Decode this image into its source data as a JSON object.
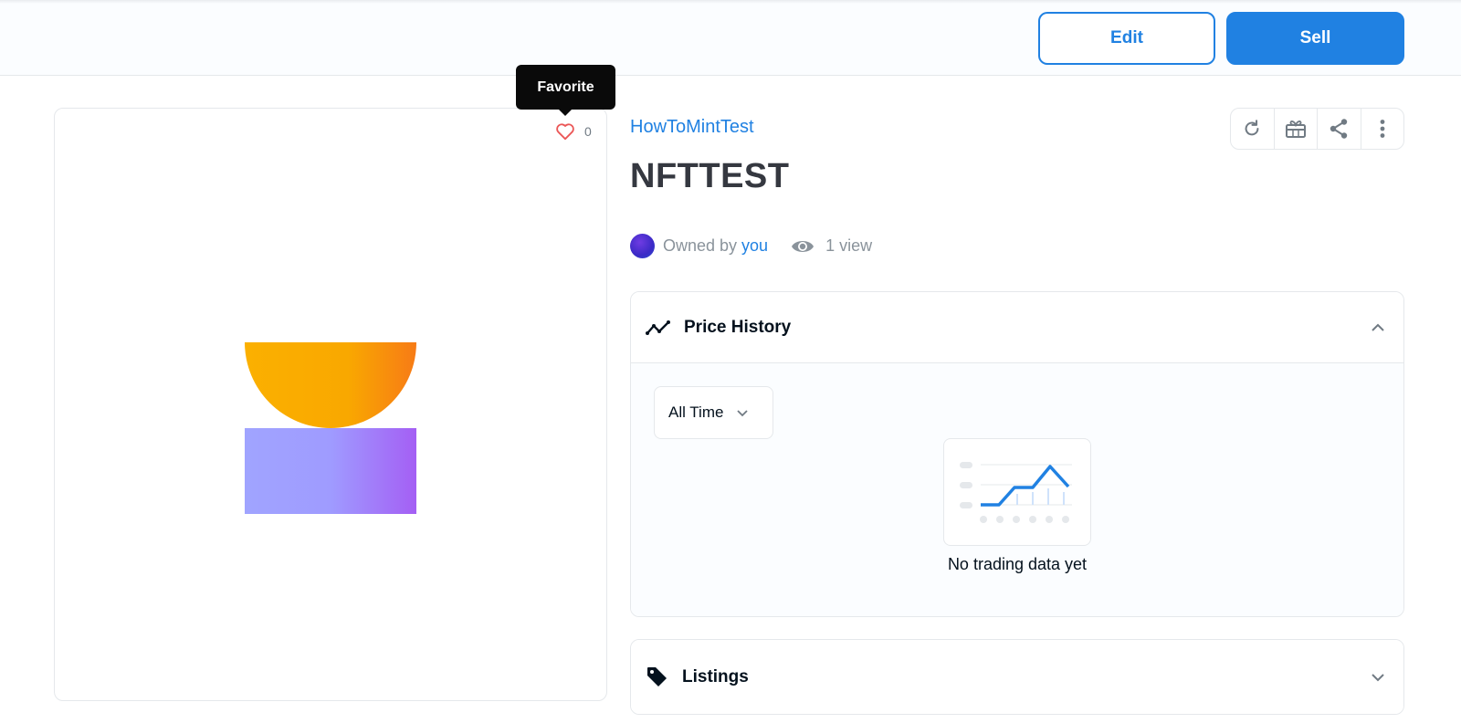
{
  "header": {
    "edit_label": "Edit",
    "sell_label": "Sell"
  },
  "tooltip": {
    "text": "Favorite"
  },
  "favorite": {
    "count": "0"
  },
  "item": {
    "collection": "HowToMintTest",
    "title": "NFTTEST",
    "owned_by_prefix": "Owned by",
    "owner": "you",
    "views": "1 view"
  },
  "actions": [
    {
      "icon": "refresh-icon"
    },
    {
      "icon": "gift-icon"
    },
    {
      "icon": "share-icon"
    },
    {
      "icon": "more-icon"
    }
  ],
  "price_history": {
    "title": "Price History",
    "filter": "All Time",
    "empty_text": "No trading data yet"
  },
  "listings": {
    "title": "Listings"
  },
  "colors": {
    "accent": "#2081e2",
    "text": "#04111d",
    "muted": "#8a939b",
    "heart": "#eb5757"
  }
}
